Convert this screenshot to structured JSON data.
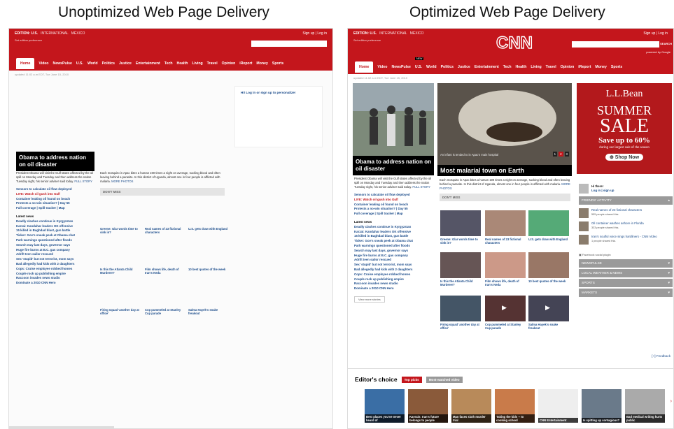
{
  "captions": {
    "left": "Unoptimized Web Page Delivery",
    "right": "Optimized Web Page Delivery"
  },
  "header": {
    "edition": "EDITION: U.S.",
    "international": "INTERNATIONAL",
    "mexico": "MÉXICO",
    "set_pref": "Set edition preference",
    "signin": "Sign up | Log in",
    "search_btn": "SEARCH",
    "powered": "powered by Google",
    "logo": "CNN"
  },
  "nav": [
    "Home",
    "Video",
    "NewsPulse",
    "U.S.",
    "World",
    "Politics",
    "Justice",
    "Entertainment",
    "Tech",
    "Health",
    "Living",
    "Travel",
    "Opinion",
    "iReport",
    "Money",
    "Sports"
  ],
  "nav_badge": "NEW",
  "updated": "updated 11:02 a.m EDT, Tue June 15, 2010",
  "welcome": "Hi! Log in or sign up to personalize!",
  "lead": {
    "title": "Obama to address nation on oil disaster",
    "text": "President Obama will visit the Gulf states affected by the oil spill on Monday and Tuesday and then address the nation Tuesday night, his senior adviser said today.",
    "more": "FULL STORY"
  },
  "bullets": [
    "Sensors to calculate oil flow deployed",
    "LIVE: Watch oil gush into Gulf",
    "Container leaking oil found on beach",
    "Protests a no-win situation? | Day 55",
    "Full coverage | Spill tracker | Map"
  ],
  "mid": {
    "photo_cap": "An infant is tended to in Apac's main hospital",
    "title": "Most malarial town on Earth",
    "text": "Each mosquito in Apac bites a human 190 times a night on average, sucking blood and often leaving behind a parasite. In this district of Uganda, almost one in four people is afflicted with malaria.",
    "more": "MORE PHOTOS",
    "pages": [
      "1",
      "2",
      "3"
    ]
  },
  "dont_miss": "DON'T MISS",
  "latest_title": "Latest news",
  "latest": [
    "Deadly clashes continue in Kyrgyzstan",
    "Karzai: Kandahar leaders OK offensive",
    "15 killed in Baghdad blast, gun battle",
    "Ticker: Gov's sneak peek at Obama chat",
    "Park warnings questioned after floods",
    "Search may last days, governor says",
    "Huge fire burns at B.C. gas company",
    "Adrift teen sailor rescued",
    "Sex 'stupid' but not terrorist, mom says",
    "Bad allegedly had kids with 2 daughters",
    "Cops: Cruise employee robbed homes",
    "Couple rock up publishing empire",
    "Raccoon invades news studio",
    "Dominate a 2010 CNN Hero"
  ],
  "more_stories": "View more stories",
  "grid": [
    "Greene: Glar words time to sink in?",
    "Real names of 23 fictional characters",
    "U.S. gets draw with England",
    "Is this the Atlanta Child Murderer?",
    "Film shows life, death of Iran's Neda",
    "10 best quotes of the week",
    "Firing squad 'another day at office'",
    "Cop pummeled at Stanley Cup parade",
    "Salma Hayek's snake freakout"
  ],
  "ad": {
    "brand": "L.L.Bean",
    "l1": "SUMMER",
    "l2": "SALE",
    "l3": "Save up to 60%",
    "l4": "during our largest sale of the season",
    "btn": "Shop Now"
  },
  "user": {
    "hi": "Hi there!",
    "login": "Log in | sign up"
  },
  "friend_title": "FRIENDS' ACTIVITY",
  "friends": [
    {
      "t": "Real names of 23 fictional characters",
      "s": "555 people shared this."
    },
    {
      "t": "Oil container washes ashore in Florida",
      "s": "333 people shared this."
    },
    {
      "t": "Iran's soulful voice sings hardliners - CNN Video",
      "s": "1 people shared this."
    }
  ],
  "fb": "Facebook social plugin",
  "side_tabs": [
    "NEWSPULSE",
    "LOCAL WEATHER & NEWS",
    "SPORTS",
    "MARKETS"
  ],
  "feedback": "Feedback",
  "editors": {
    "title": "Editor's choice",
    "tab1": "Top picks",
    "tab2": "Most-watched video",
    "items": [
      "Best places you've never heard of",
      "Kavrain: Iran's future belongs to people",
      "Man faces sixth murder trial",
      "Taking the kids -- to cooking school",
      "CNN Entertainment",
      "Is spitting up contagious?",
      "Bad medical writing hurts public"
    ]
  },
  "colors": {
    "cnn_red": "#c4161c",
    "link": "#1a4b8a"
  }
}
